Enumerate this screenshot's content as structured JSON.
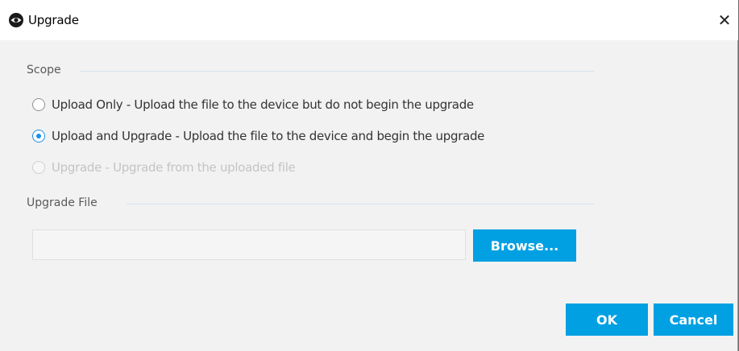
{
  "window": {
    "title": "Upgrade",
    "app_icon": "eye-logo-icon",
    "close_glyph": "✕"
  },
  "scope": {
    "label": "Scope",
    "options": [
      {
        "label": "Upload Only - Upload the file to the device but do not begin the upgrade",
        "checked": false,
        "disabled": false
      },
      {
        "label": "Upload and Upgrade - Upload the file to the device and begin the upgrade",
        "checked": true,
        "disabled": false
      },
      {
        "label": "Upgrade - Upgrade from the uploaded file",
        "checked": false,
        "disabled": true
      }
    ]
  },
  "upgrade_file": {
    "label": "Upgrade File",
    "value": "",
    "placeholder": "",
    "browse_label": "Browse..."
  },
  "footer": {
    "ok_label": "OK",
    "cancel_label": "Cancel"
  },
  "colors": {
    "accent": "#00a0e3",
    "radio_selected": "#1e90e6"
  }
}
